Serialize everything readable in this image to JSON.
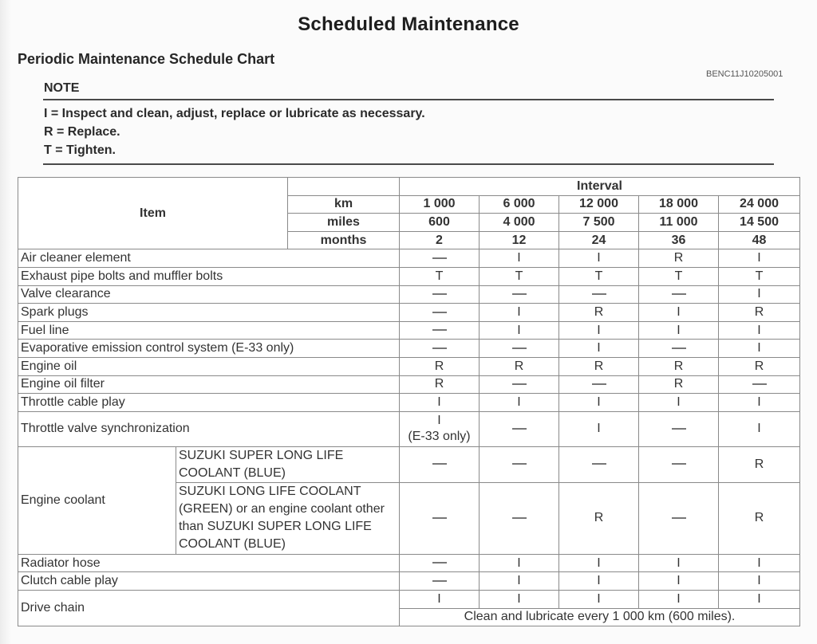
{
  "page_title": "Scheduled Maintenance",
  "section_title": "Periodic Maintenance Schedule Chart",
  "doc_code": "BENC11J10205001",
  "note": {
    "label": "NOTE",
    "lines": [
      "I = Inspect and clean, adjust, replace or lubricate as necessary.",
      "R = Replace.",
      "T = Tighten."
    ]
  },
  "table": {
    "item_header": "Item",
    "interval_header": "Interval",
    "units": [
      "km",
      "miles",
      "months"
    ],
    "intervals": {
      "km": [
        "1 000",
        "6 000",
        "12 000",
        "18 000",
        "24 000"
      ],
      "miles": [
        "600",
        "4 000",
        "7 500",
        "11 000",
        "14 500"
      ],
      "months": [
        "2",
        "12",
        "24",
        "36",
        "48"
      ]
    },
    "rows": [
      {
        "item": "Air cleaner element",
        "values": [
          "—",
          "I",
          "I",
          "R",
          "I"
        ]
      },
      {
        "item": "Exhaust pipe bolts and muffler bolts",
        "values": [
          "T",
          "T",
          "T",
          "T",
          "T"
        ]
      },
      {
        "item": "Valve clearance",
        "values": [
          "—",
          "—",
          "—",
          "—",
          "I"
        ]
      },
      {
        "item": "Spark plugs",
        "values": [
          "—",
          "I",
          "R",
          "I",
          "R"
        ]
      },
      {
        "item": "Fuel line",
        "values": [
          "—",
          "I",
          "I",
          "I",
          "I"
        ]
      },
      {
        "item": "Evaporative emission control system (E-33 only)",
        "values": [
          "—",
          "—",
          "I",
          "—",
          "I"
        ]
      },
      {
        "item": "Engine oil",
        "values": [
          "R",
          "R",
          "R",
          "R",
          "R"
        ]
      },
      {
        "item": "Engine oil filter",
        "values": [
          "R",
          "—",
          "—",
          "R",
          "—"
        ]
      },
      {
        "item": "Throttle cable play",
        "values": [
          "I",
          "I",
          "I",
          "I",
          "I"
        ]
      },
      {
        "item": "Throttle valve synchronization",
        "values": [
          "I",
          "—",
          "I",
          "—",
          "I"
        ],
        "first_note": "(E-33 only)"
      }
    ],
    "coolant": {
      "item": "Engine coolant",
      "variants": [
        {
          "label": "SUZUKI SUPER LONG LIFE COOLANT (BLUE)",
          "values": [
            "—",
            "—",
            "—",
            "—",
            "R"
          ]
        },
        {
          "label": "SUZUKI LONG LIFE COOLANT (GREEN) or an engine coolant other than SUZUKI SUPER LONG LIFE COOLANT (BLUE)",
          "values": [
            "—",
            "—",
            "R",
            "—",
            "R"
          ]
        }
      ]
    },
    "rows_after": [
      {
        "item": "Radiator hose",
        "values": [
          "—",
          "I",
          "I",
          "I",
          "I"
        ]
      },
      {
        "item": "Clutch cable play",
        "values": [
          "—",
          "I",
          "I",
          "I",
          "I"
        ]
      }
    ],
    "drive_chain": {
      "item": "Drive chain",
      "values": [
        "I",
        "I",
        "I",
        "I",
        "I"
      ],
      "note": "Clean and lubricate every 1 000 km (600 miles)."
    }
  }
}
